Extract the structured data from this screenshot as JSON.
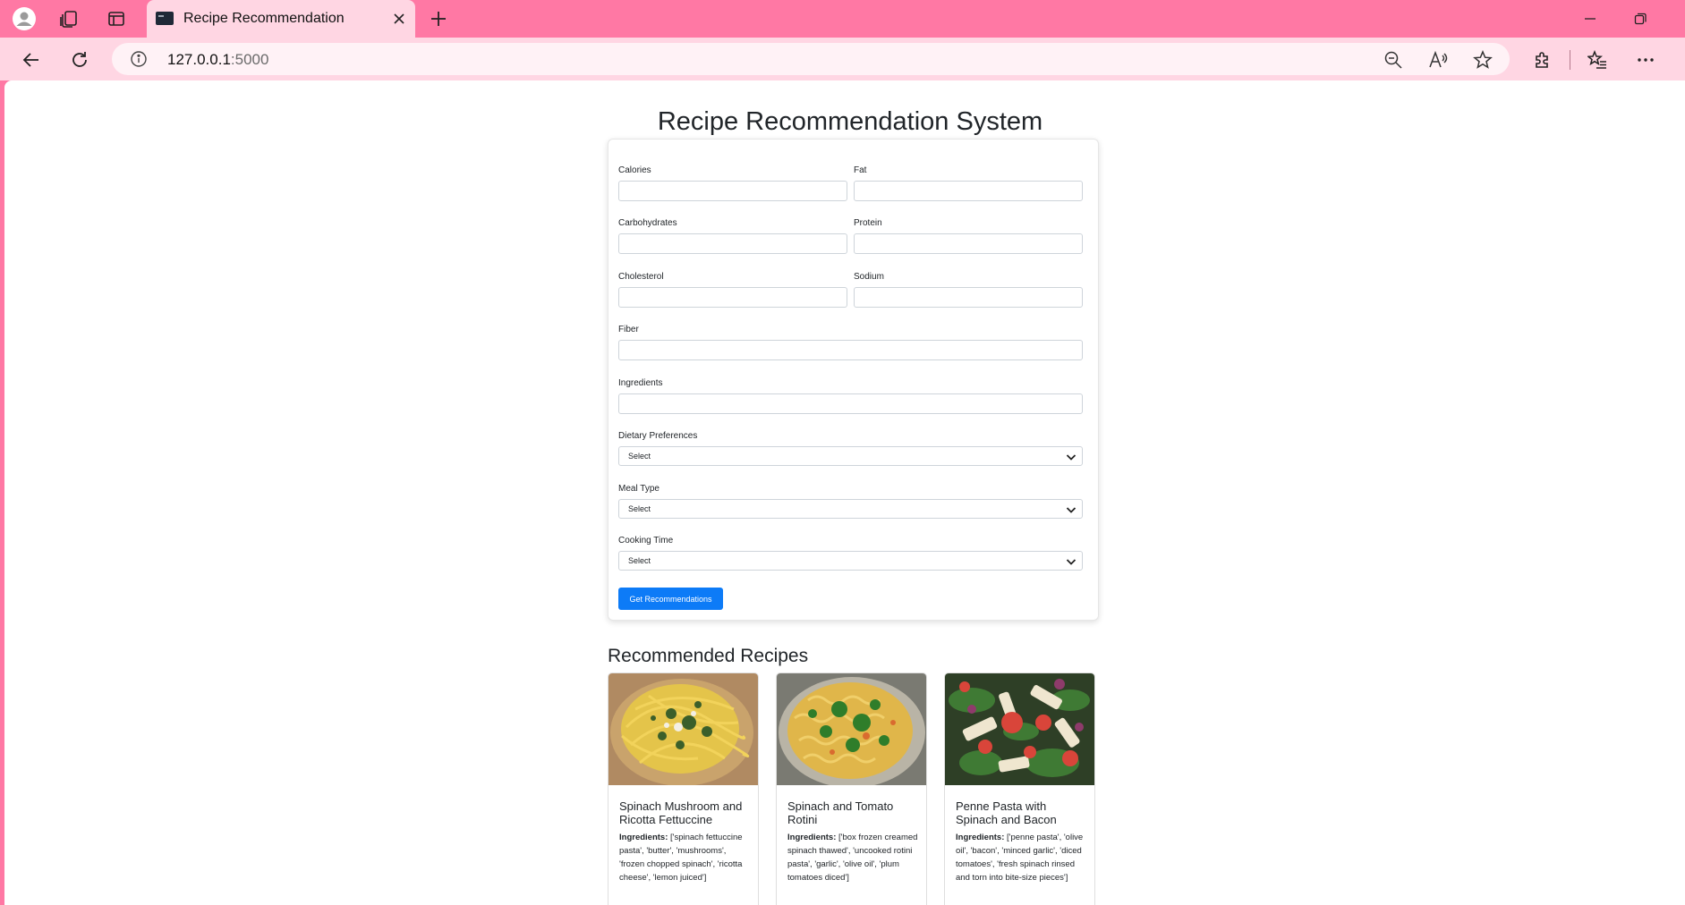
{
  "browser": {
    "tab_title": "Recipe Recommendation",
    "url_host": "127.0.0.1",
    "url_port": ":5000"
  },
  "page": {
    "title": "Recipe Recommendation System"
  },
  "form": {
    "calories_label": "Calories",
    "fat_label": "Fat",
    "carbohydrates_label": "Carbohydrates",
    "protein_label": "Protein",
    "cholesterol_label": "Cholesterol",
    "sodium_label": "Sodium",
    "fiber_label": "Fiber",
    "ingredients_label": "Ingredients",
    "dietary_label": "Dietary Preferences",
    "dietary_value": "Select",
    "meal_label": "Meal Type",
    "meal_value": "Select",
    "cooking_label": "Cooking Time",
    "cooking_value": "Select",
    "submit_label": "Get Recommendations"
  },
  "recommendations": {
    "heading": "Recommended Recipes",
    "ingredients_prefix": "Ingredients:",
    "items": [
      {
        "title": "Spinach Mushroom and Ricotta Fettuccine",
        "ingredients": "['spinach fettuccine pasta', 'butter', 'mushrooms', 'frozen chopped spinach', 'ricotta cheese', 'lemon juiced']"
      },
      {
        "title": "Spinach and Tomato Rotini",
        "ingredients": "['box frozen creamed spinach thawed', 'uncooked rotini pasta', 'garlic', 'olive oil', 'plum tomatoes diced']"
      },
      {
        "title": "Penne Pasta with Spinach and Bacon",
        "ingredients": "['penne pasta', 'olive oil', 'bacon', 'minced garlic', 'diced tomatoes', 'fresh spinach rinsed and torn into bite-size pieces']"
      }
    ]
  },
  "colors": {
    "chrome_pink": "#ff78a4",
    "chrome_light": "#ffd6e3",
    "primary_button": "#0d7bf7"
  }
}
